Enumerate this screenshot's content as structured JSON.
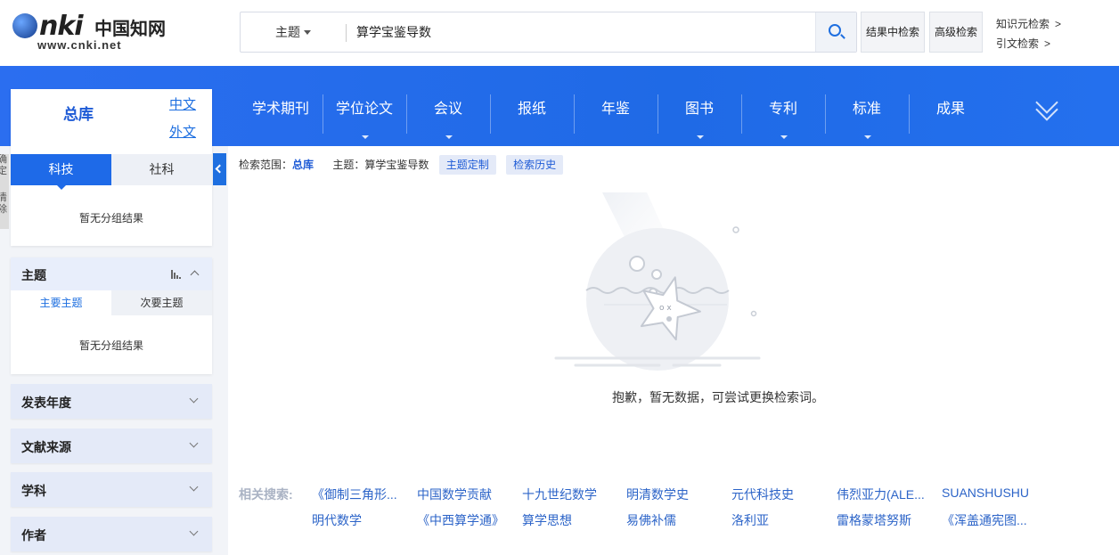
{
  "logo": {
    "brand": "CNKI",
    "chinese_name": "中国知网",
    "url_text": "www.cnki.net"
  },
  "search": {
    "field": "主题",
    "query": "算学宝鉴导数",
    "in_results_label": "结果中检索",
    "advanced_label": "高级检索",
    "knowledge_link": "知识元检索",
    "citation_link": "引文检索",
    "arrow": ">"
  },
  "nav": {
    "items": [
      {
        "label": "学术期刊",
        "dropdown": false
      },
      {
        "label": "学位论文",
        "dropdown": true
      },
      {
        "label": "会议",
        "dropdown": true
      },
      {
        "label": "报纸",
        "dropdown": false
      },
      {
        "label": "年鉴",
        "dropdown": false
      },
      {
        "label": "图书",
        "dropdown": true
      },
      {
        "label": "专利",
        "dropdown": true
      },
      {
        "label": "标准",
        "dropdown": true
      },
      {
        "label": "成果",
        "dropdown": false
      }
    ]
  },
  "library": {
    "title": "总库",
    "lang_cn": "中文",
    "lang_foreign": "外文",
    "tab_sci": "科技",
    "tab_soc": "社科",
    "empty": "暂无分组结果"
  },
  "side_clip": [
    "确",
    "定",
    "清",
    "除"
  ],
  "topic": {
    "title": "主题",
    "tab_main": "主要主题",
    "tab_sub": "次要主题",
    "empty": "暂无分组结果"
  },
  "facets": {
    "year": "发表年度",
    "source": "文献来源",
    "subject": "学科",
    "author": "作者"
  },
  "breadcrumb": {
    "scope_label": "检索范围：",
    "scope_value": "总库",
    "topic_label": "主题：",
    "topic_value": "算学宝鉴导数",
    "topic_custom": "主题定制",
    "history": "检索历史"
  },
  "empty_message": "抱歉，暂无数据，可尝试更换检索词。",
  "related": {
    "label": "相关搜索:",
    "row1": [
      "《御制三角形...",
      "中国数学贡献",
      "十九世纪数学",
      "明清数学史",
      "元代科技史",
      "伟烈亚力(ALE...",
      "SUANSHUSHU"
    ],
    "row2": [
      "明代数学",
      "《中西算学通》",
      "算学思想",
      "易佛补儒",
      "洛利亚",
      "雷格蒙塔努斯",
      "《浑盖通宪图..."
    ]
  },
  "colors": {
    "primary": "#1e6fe0",
    "nav_bg": "#2470ee",
    "facet_bg": "#e4eaf8",
    "page_bg": "#f2f4f8"
  }
}
